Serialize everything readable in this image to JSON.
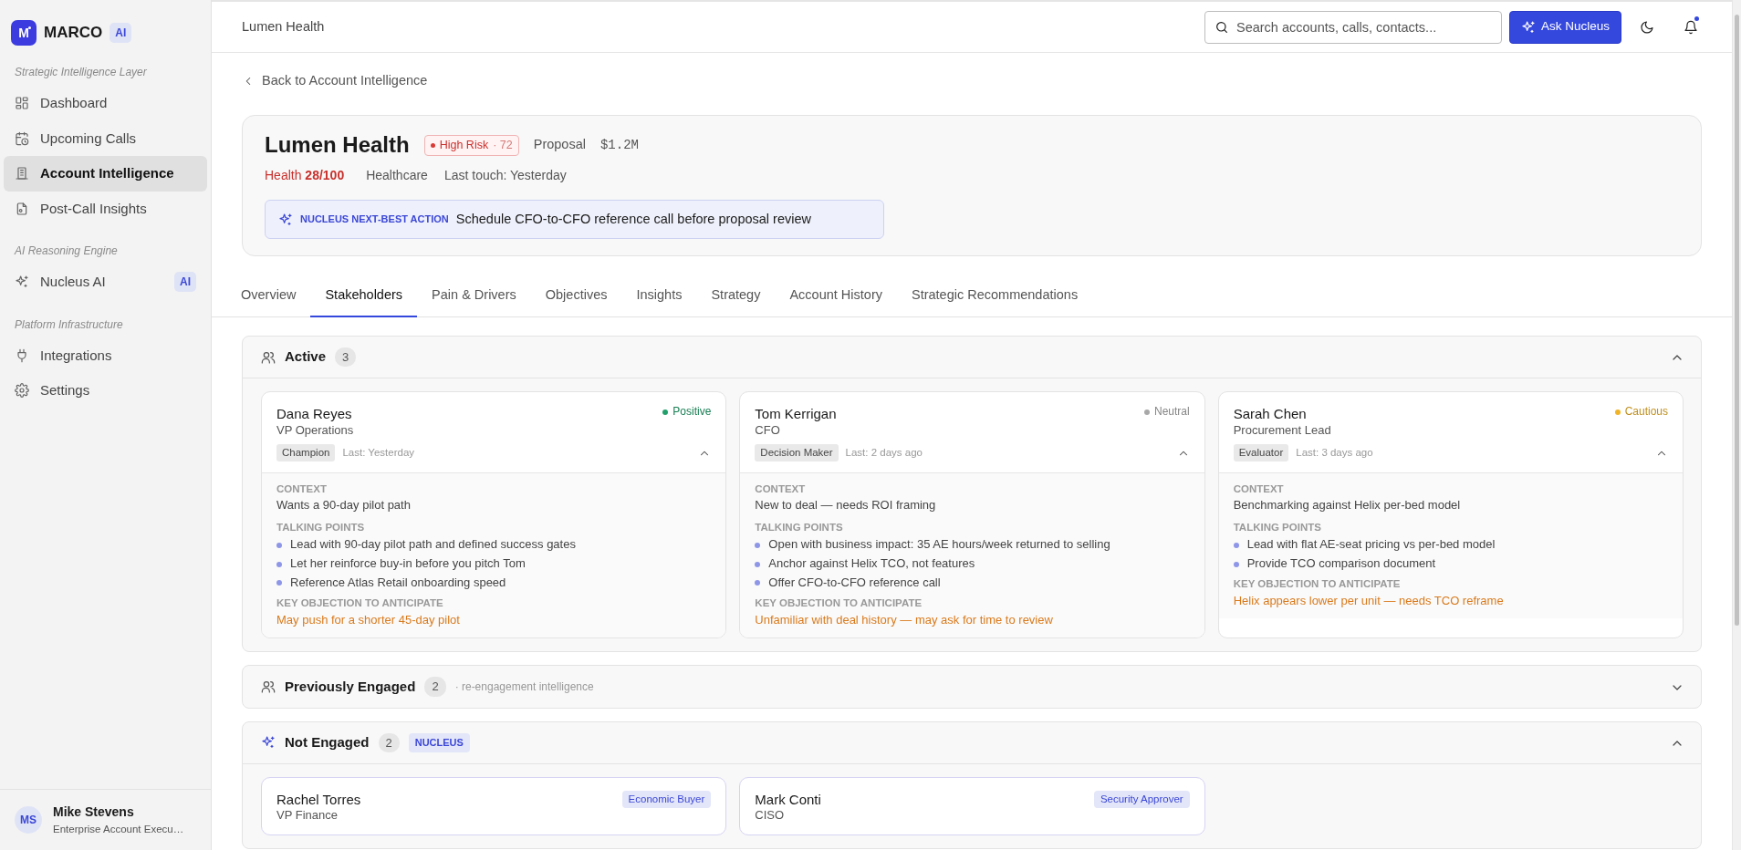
{
  "brand": {
    "logo": "M",
    "name": "MARCO",
    "badge": "AI"
  },
  "sidebar": {
    "groups": [
      {
        "heading": "Strategic Intelligence Layer",
        "items": [
          {
            "label": "Dashboard",
            "selected": false
          },
          {
            "label": "Upcoming Calls",
            "selected": false
          },
          {
            "label": "Account Intelligence",
            "selected": true
          },
          {
            "label": "Post-Call Insights",
            "selected": false
          }
        ]
      },
      {
        "heading": "AI Reasoning Engine",
        "items": [
          {
            "label": "Nucleus AI",
            "selected": false,
            "badge": "AI"
          }
        ]
      },
      {
        "heading": "Platform Infrastructure",
        "items": [
          {
            "label": "Integrations",
            "selected": false
          },
          {
            "label": "Settings",
            "selected": false
          }
        ]
      }
    ]
  },
  "user": {
    "initials": "MS",
    "name": "Mike Stevens",
    "role": "Enterprise Account Execu…"
  },
  "header": {
    "title": "Lumen Health",
    "search": {
      "placeholder": "Search accounts, calls, contacts..."
    },
    "ask_button": "Ask Nucleus",
    "notification_unread": true
  },
  "back_link": "Back to Account Intelligence",
  "account": {
    "name": "Lumen Health",
    "risk": {
      "label": "High Risk",
      "score": "· 72"
    },
    "stage": "Proposal",
    "value": "$1.2M",
    "health_label": "Health",
    "health": "28/100",
    "industry": "Healthcare",
    "last_touch": "Last touch: Yesterday",
    "next_action": {
      "label": "NUCLEUS NEXT-BEST ACTION",
      "text": "Schedule CFO-to-CFO reference call before proposal review"
    }
  },
  "tabs": [
    {
      "label": "Overview",
      "selected": false
    },
    {
      "label": "Stakeholders",
      "selected": true
    },
    {
      "label": "Pain & Drivers",
      "selected": false
    },
    {
      "label": "Objectives",
      "selected": false
    },
    {
      "label": "Insights",
      "selected": false
    },
    {
      "label": "Strategy",
      "selected": false
    },
    {
      "label": "Account History",
      "selected": false
    },
    {
      "label": "Strategic Recommendations",
      "selected": false
    }
  ],
  "sections": [
    {
      "kind": "people",
      "title": "Active",
      "count": "3",
      "expanded": true,
      "stakeholders": [
        {
          "name": "Dana Reyes",
          "title": "VP Operations",
          "status": {
            "label": "Positive",
            "color": "#22a06b"
          },
          "tag": "Champion",
          "last": "Last: Yesterday",
          "expanded": true,
          "context_label": "CONTEXT",
          "context": "Wants a 90-day pilot path",
          "points_label": "TALKING POINTS",
          "points": [
            "Lead with 90-day pilot path and defined success gates",
            "Let her reinforce buy-in before you pitch Tom",
            "Reference Atlas Retail onboarding speed"
          ],
          "objection_label": "KEY OBJECTION TO ANTICIPATE",
          "objection": "May push for a shorter 45-day pilot"
        },
        {
          "name": "Tom Kerrigan",
          "title": "CFO",
          "status": {
            "label": "Neutral",
            "color": "#a8a8a8"
          },
          "tag": "Decision Maker",
          "last": "Last: 2 days ago",
          "expanded": true,
          "context_label": "CONTEXT",
          "context": "New to deal — needs ROI framing",
          "points_label": "TALKING POINTS",
          "points": [
            "Open with business impact: 35 AE hours/week returned to selling",
            "Anchor against Helix TCO, not features",
            "Offer CFO-to-CFO reference call"
          ],
          "objection_label": "KEY OBJECTION TO ANTICIPATE",
          "objection": "Unfamiliar with deal history — may ask for time to review"
        },
        {
          "name": "Sarah Chen",
          "title": "Procurement Lead",
          "status": {
            "label": "Cautious",
            "color": "#f0b429"
          },
          "tag": "Evaluator",
          "last": "Last: 3 days ago",
          "expanded": true,
          "context_label": "CONTEXT",
          "context": "Benchmarking against Helix per-bed model",
          "points_label": "TALKING POINTS",
          "points": [
            "Lead with flat AE-seat pricing vs per-bed model",
            "Provide TCO comparison document"
          ],
          "objection_label": "KEY OBJECTION TO ANTICIPATE",
          "objection": "Helix appears lower per unit — needs TCO reframe"
        }
      ]
    },
    {
      "kind": "people",
      "title": "Previously Engaged",
      "count": "2",
      "note": "· re-engagement intelligence",
      "expanded": false
    },
    {
      "kind": "ai",
      "title": "Not Engaged",
      "count": "2",
      "tag": "NUCLEUS",
      "expanded": true,
      "stakeholders": [
        {
          "name": "Rachel Torres",
          "title": "VP Finance",
          "role_tag": "Economic Buyer"
        },
        {
          "name": "Mark Conti",
          "title": "CISO",
          "role_tag": "Security Approver"
        }
      ]
    }
  ]
}
